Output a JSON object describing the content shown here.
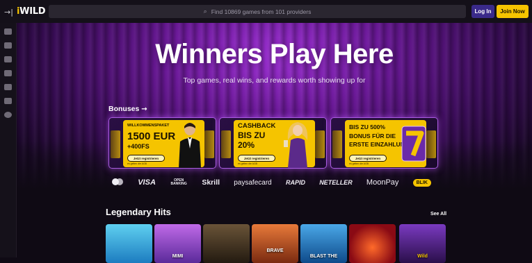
{
  "header": {
    "logo_i": "i",
    "logo_rest": "WILD",
    "search_placeholder": "Find 10869 games from 101 providers",
    "login_label": "Log In",
    "join_label": "Join Now"
  },
  "sidebar": {
    "icons": [
      "collapse-icon",
      "grid-icon",
      "cards-icon",
      "ticket-icon",
      "blocks-icon",
      "gift-icon",
      "tv-icon",
      "settings-icon"
    ]
  },
  "hero": {
    "headline": "Winners Play Here",
    "subline": "Top games, real wins, and rewards worth showing up for"
  },
  "bonuses": {
    "title": "Bonuses",
    "arrow": "→",
    "cards": [
      {
        "tag": "WILLKOMMENSPAKET",
        "line1": "1500 EUR",
        "line2": "+400FS",
        "cta": "Jetzt registrieren",
        "fine": "es gelten die AGB"
      },
      {
        "tag": "",
        "line1": "CASHBACK",
        "line2": "BIS ZU",
        "line3": "20%",
        "cta": "Jetzt registrieren",
        "fine": "es gelten die AGB"
      },
      {
        "tag": "",
        "line1": "BIS ZU 500%",
        "line2": "BONUS FÜR DIE",
        "line3": "ERSTE EINZAHLUNG",
        "cta": "Jetzt registrieren",
        "fine": "es gelten die AGB"
      }
    ]
  },
  "payments": [
    "VISA",
    "OPEN BANKING",
    "Skrill",
    "paysafecard",
    "RAPID",
    "NETELLER",
    "MoonPay",
    "BLIK"
  ],
  "hits": {
    "title": "Legendary Hits",
    "see_all": "See All",
    "tiles": [
      {
        "label": "",
        "color": "#2aa6d6"
      },
      {
        "label": "MIMI",
        "color": "#8a3fb8"
      },
      {
        "label": "",
        "color": "#3a2a1a"
      },
      {
        "label": "BRAVE",
        "color": "#b84a28"
      },
      {
        "label": "BLAST THE",
        "color": "#1f6fb0"
      },
      {
        "label": "",
        "color": "#a0141c"
      },
      {
        "label": "Wild",
        "color": "#4a1f7a"
      }
    ]
  },
  "colors": {
    "accent": "#f5c400",
    "login": "#3a2a8a",
    "purple": "#7a1fb3"
  }
}
